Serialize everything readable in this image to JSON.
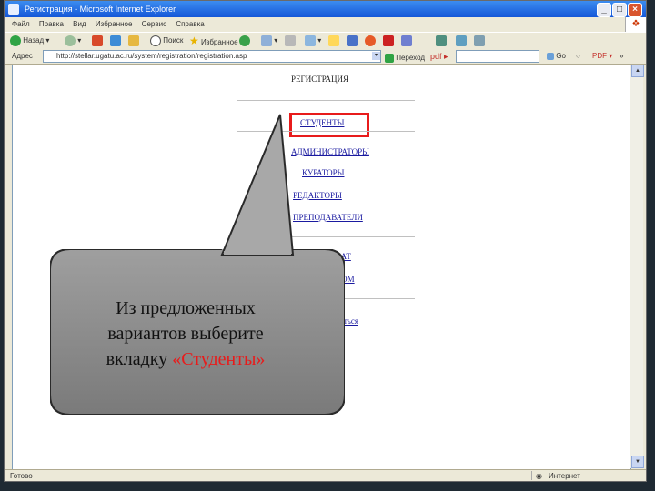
{
  "window": {
    "title": "Регистрация - Microsoft Internet Explorer"
  },
  "menu": [
    "Файл",
    "Правка",
    "Вид",
    "Избранное",
    "Сервис",
    "Справка"
  ],
  "toolbar": {
    "back_label": "Назад",
    "search_label": "Поиск",
    "favorites_label": "Избранное"
  },
  "address": {
    "label": "Адрес",
    "url": "http://stellar.ugatu.ac.ru/system/registration/registration.asp",
    "go_label": "Переход",
    "go2_label": "Go"
  },
  "page": {
    "heading": "РЕГИСТРАЦИЯ",
    "links": [
      "СТУДЕНТЫ",
      "АДМИНИСТРАТОРЫ",
      "КУРАТОРЫ",
      "РЕДАКТОРЫ",
      "ПРЕПОДАВАТЕЛИ",
      "ДЕКАНАТ",
      "ПРОФКОМ",
      "Вернуться"
    ]
  },
  "callout": {
    "text_line1": "Из предложенных",
    "text_line2": "вариантов выберите",
    "text_line3_prefix": "вкладку ",
    "text_highlight": "«Студенты»",
    "fill": "#8a8a8a",
    "highlight_color": "#e81b1b"
  },
  "status": {
    "left": "Готово",
    "right": "Интернет"
  }
}
